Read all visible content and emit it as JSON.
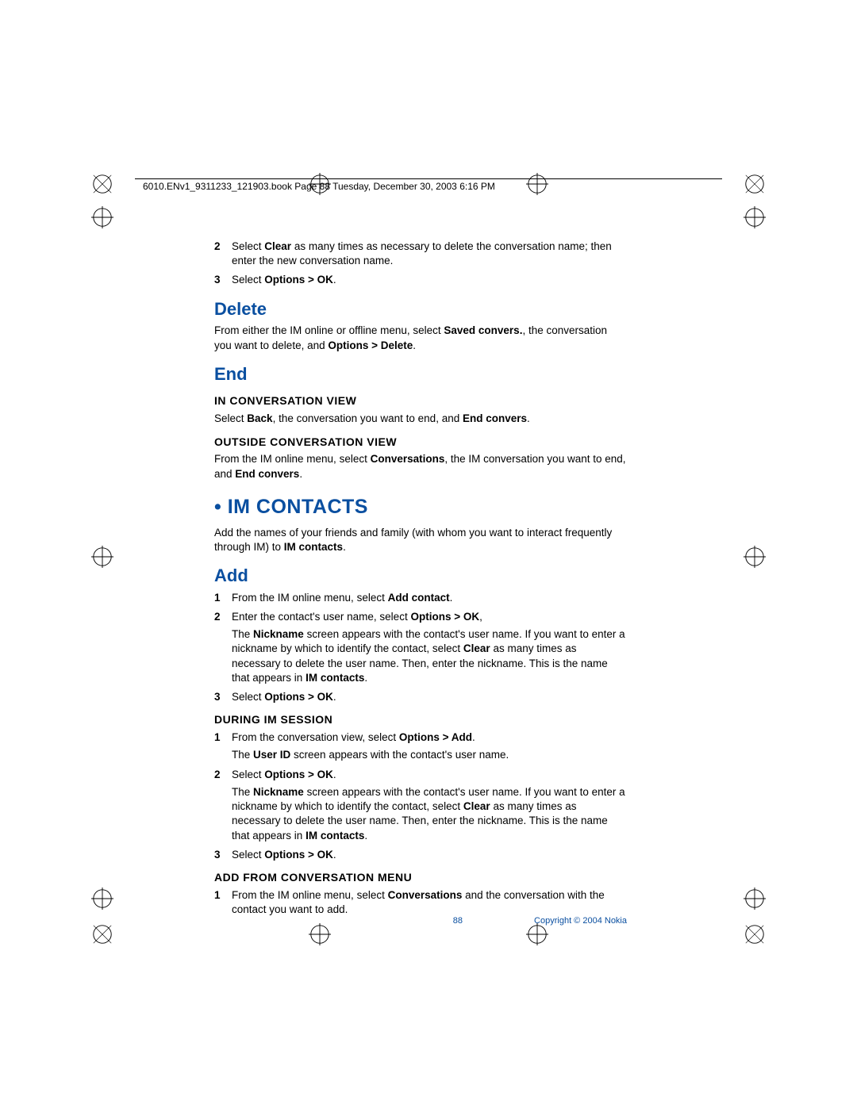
{
  "header": "6010.ENv1_9311233_121903.book  Page 88  Tuesday, December 30, 2003  6:16 PM",
  "step2": {
    "num": "2",
    "pre": "Select ",
    "b1": "Clear",
    "post": " as many times as necessary to delete the conversation name; then enter the new conversation name."
  },
  "step3": {
    "num": "3",
    "pre": "Select ",
    "b1": "Options > OK",
    "post": "."
  },
  "delete": {
    "title": "Delete",
    "para": {
      "pre": "From either the IM online or offline menu, select ",
      "b1": "Saved convers.",
      "mid": ", the conversation you want to delete, and ",
      "b2": "Options > Delete",
      "post": "."
    }
  },
  "end": {
    "title": "End",
    "sub1": "IN CONVERSATION VIEW",
    "sub1_para": {
      "pre": "Select ",
      "b1": "Back",
      "mid": ", the conversation you want to end, and ",
      "b2": "End convers",
      "post": "."
    },
    "sub2": "OUTSIDE CONVERSATION VIEW",
    "sub2_para": {
      "pre": "From the IM online menu, select ",
      "b1": "Conversations",
      "mid": ", the IM conversation you want to end, and ",
      "b2": "End convers",
      "post": "."
    }
  },
  "imcontacts": {
    "title": " • IM CONTACTS",
    "intro": {
      "pre": "Add the names of your friends and family (with whom you want to interact frequently through IM) to ",
      "b1": "IM contacts",
      "post": "."
    }
  },
  "add": {
    "title": "Add",
    "s1": {
      "num": "1",
      "pre": "From the IM online menu, select ",
      "b1": "Add contact",
      "post": "."
    },
    "s2": {
      "num": "2",
      "pre": "Enter the contact's user name, select ",
      "b1": "Options > OK",
      "post": ",",
      "sub_pre": "The ",
      "sub_b1": "Nickname",
      "sub_mid": " screen appears with the contact's user name. If you want to enter a nickname by which to identify the contact, select ",
      "sub_b2": "Clear",
      "sub_mid2": " as many times as necessary to delete the user name. Then, enter the nickname. This is the name that appears in ",
      "sub_b3": "IM contacts",
      "sub_post": "."
    },
    "s3": {
      "num": "3",
      "pre": "Select ",
      "b1": "Options > OK",
      "post": "."
    }
  },
  "during": {
    "title": "DURING IM SESSION",
    "s1": {
      "num": "1",
      "pre": "From the conversation view, select ",
      "b1": "Options > Add",
      "post": ".",
      "sub_pre": "The ",
      "sub_b1": "User ID",
      "sub_post": " screen appears with the contact's user name."
    },
    "s2": {
      "num": "2",
      "pre": "Select ",
      "b1": "Options > OK",
      "post": ".",
      "sub_pre": "The ",
      "sub_b1": "Nickname",
      "sub_mid": " screen appears with the contact's user name. If you want to enter a nickname by which to identify the contact, select ",
      "sub_b2": "Clear",
      "sub_mid2": " as many times as necessary to delete the user name. Then, enter the nickname. This is the name that appears in ",
      "sub_b3": "IM contacts",
      "sub_post": "."
    },
    "s3": {
      "num": "3",
      "pre": "Select ",
      "b1": "Options > OK",
      "post": "."
    }
  },
  "addfrom": {
    "title": "ADD FROM CONVERSATION MENU",
    "s1": {
      "num": "1",
      "pre": "From the IM online menu, select ",
      "b1": "Conversations",
      "post": " and the conversation with the contact you want to add."
    }
  },
  "footer": {
    "page": "88",
    "copyright": "Copyright © 2004 Nokia"
  }
}
